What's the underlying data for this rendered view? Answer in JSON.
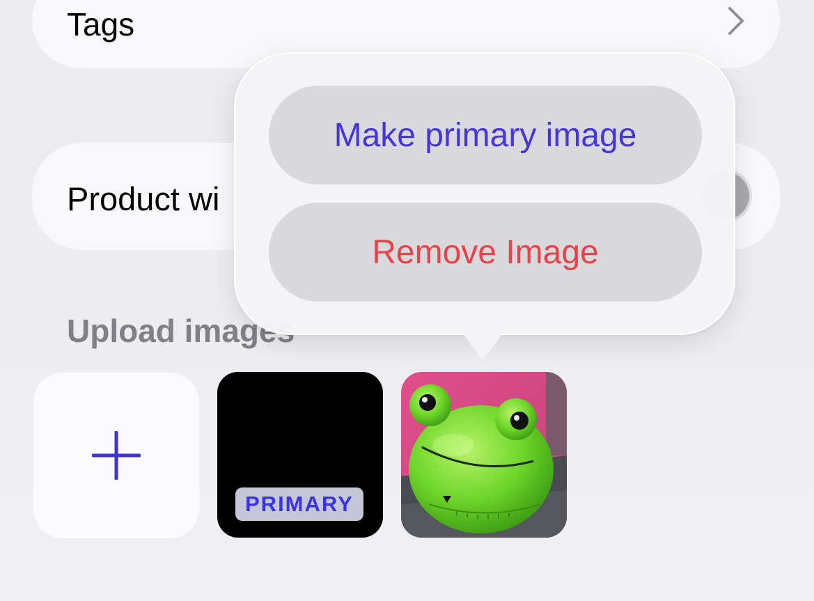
{
  "rows": {
    "tags_label": "Tags",
    "tags_chevron_icon": "chevron-right-icon",
    "product_label": "Product wi"
  },
  "section": {
    "upload_header": "Upload images"
  },
  "tiles": {
    "add_icon": "plus-icon",
    "primary_badge": "PRIMARY",
    "frog_image": "frog-kitchen-timer-photo"
  },
  "popover": {
    "make_primary": "Make primary image",
    "remove_image": "Remove Image"
  },
  "colors": {
    "accent": "#4536d9",
    "destructive": "#e8434c",
    "badge_bg": "#c5c6d8"
  }
}
